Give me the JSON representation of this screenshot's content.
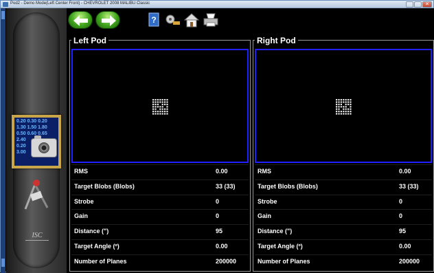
{
  "window": {
    "title": "Pod2 - Demo Mode(Left Center Front) - CHEVROLET 2008 MALIBU Classic",
    "controls": {
      "close_glyph": "✕"
    }
  },
  "sidebar": {
    "stats_lines": [
      "0.20 0.30 0.20",
      "1.30 1.50 1.80",
      "0.50 0.60 0.65",
      "2.40",
      "0.20",
      "3.00"
    ],
    "logo_text": "ISC"
  },
  "toolbar": {
    "back_icon": "arrow-left-icon",
    "forward_icon": "arrow-right-icon",
    "tools": [
      "help-icon",
      "settings-icon",
      "home-icon",
      "print-icon"
    ]
  },
  "pods": [
    {
      "title": "Left Pod",
      "rows": [
        {
          "label": "RMS",
          "value": "0.00"
        },
        {
          "label": "Target Blobs (Blobs)",
          "value": "33 (33)"
        },
        {
          "label": "Strobe",
          "value": "0"
        },
        {
          "label": "Gain",
          "value": "0"
        },
        {
          "label": "Distance (\")",
          "value": "95"
        },
        {
          "label": "Target Angle (º)",
          "value": "0.00"
        },
        {
          "label": "Number of Planes",
          "value": "200000"
        }
      ]
    },
    {
      "title": "Right Pod",
      "rows": [
        {
          "label": "RMS",
          "value": "0.00"
        },
        {
          "label": "Target Blobs (Blobs)",
          "value": "33 (33)"
        },
        {
          "label": "Strobe",
          "value": "0"
        },
        {
          "label": "Gain",
          "value": "0"
        },
        {
          "label": "Distance (\")",
          "value": "95"
        },
        {
          "label": "Target Angle (º)",
          "value": "0.00"
        },
        {
          "label": "Number of Planes",
          "value": "200000"
        }
      ]
    }
  ],
  "colors": {
    "viewport_border": "#1f1fff",
    "stats_tile_border": "#c9a54a",
    "nav_button": "#3fa31c"
  }
}
